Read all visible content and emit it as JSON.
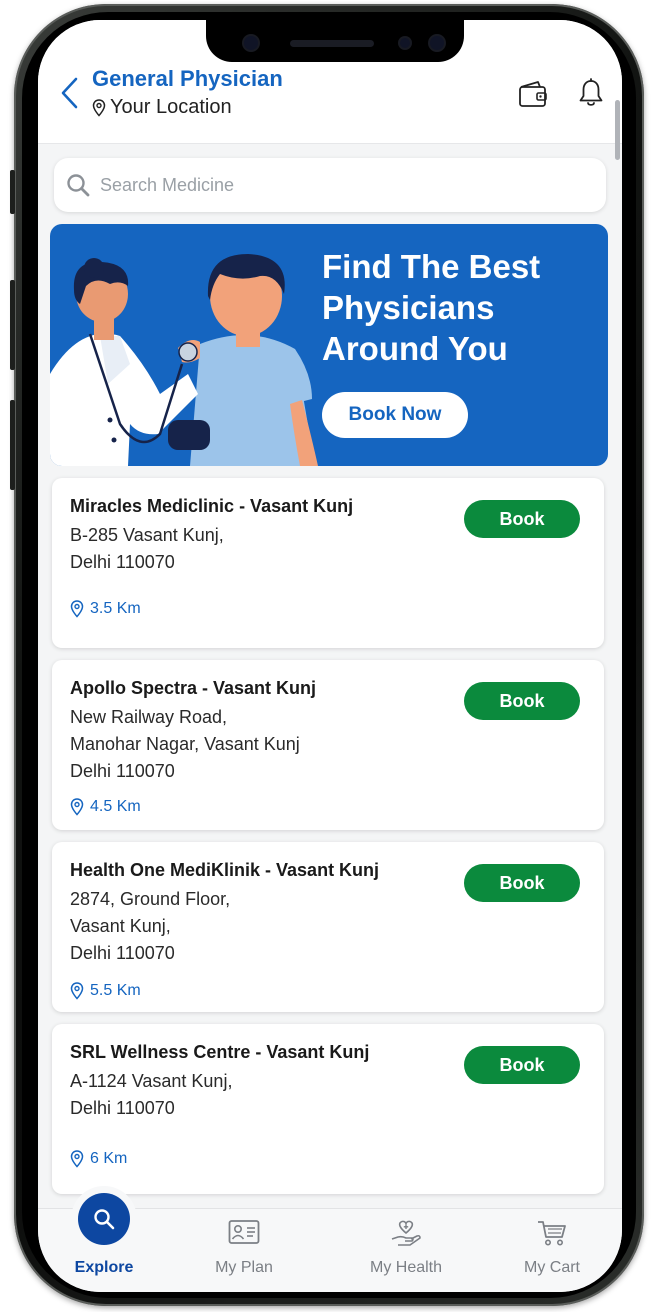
{
  "header": {
    "title": "General Physician",
    "location": "Your Location"
  },
  "search": {
    "placeholder": "Search Medicine"
  },
  "banner": {
    "title": "Find The Best Physicians Around You",
    "cta": "Book Now"
  },
  "clinics": [
    {
      "name": "Miracles Mediclinic - Vasant Kunj",
      "address": [
        "B-285 Vasant Kunj,",
        "Delhi 110070"
      ],
      "distance": "3.5 Km",
      "book_label": "Book"
    },
    {
      "name": "Apollo Spectra - Vasant Kunj",
      "address": [
        "New Railway Road,",
        "Manohar Nagar, Vasant Kunj",
        "Delhi 110070"
      ],
      "distance": "4.5 Km",
      "book_label": "Book"
    },
    {
      "name": "Health One MediKlinik - Vasant Kunj",
      "address": [
        "2874, Ground Floor,",
        "Vasant Kunj,",
        "Delhi 110070"
      ],
      "distance": "5.5 Km",
      "book_label": "Book"
    },
    {
      "name": "SRL Wellness Centre - Vasant Kunj",
      "address": [
        "A-1124 Vasant Kunj,",
        "Delhi 110070"
      ],
      "distance": "6 Km",
      "book_label": "Book"
    }
  ],
  "bottom_nav": [
    {
      "label": "Explore",
      "icon": "search-icon",
      "active": true
    },
    {
      "label": "My Plan",
      "icon": "id-card-icon",
      "active": false
    },
    {
      "label": "My Health",
      "icon": "health-hand-icon",
      "active": false
    },
    {
      "label": "My Cart",
      "icon": "cart-icon",
      "active": false
    }
  ],
  "colors": {
    "primary": "#1565c0",
    "book_button": "#0b8a3d",
    "active_nav": "#0d47a1"
  }
}
